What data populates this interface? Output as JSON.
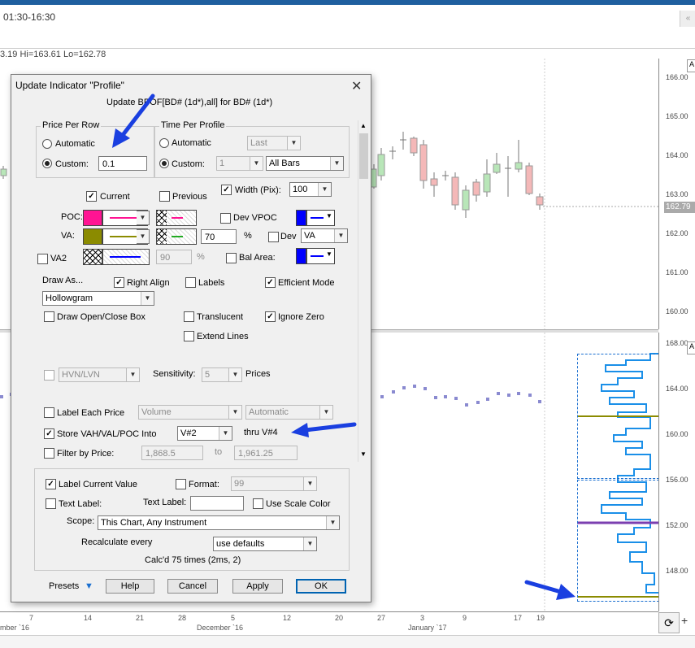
{
  "chart": {
    "title": "01:30-16:30",
    "stats": "3.19 Hi=163.61 Lo=162.78",
    "corner_button": "«",
    "right_axis_label": "A",
    "last_price": "162.79",
    "upper_ticks": [
      "166.00",
      "165.00",
      "164.00",
      "163.00",
      "162.00",
      "161.00",
      "160.00"
    ],
    "lower_ticks": [
      "168.00",
      "164.00",
      "160.00",
      "156.00",
      "152.00",
      "148.00"
    ],
    "date_ticks": [
      "7",
      "14",
      "21",
      "28",
      "5",
      "12",
      "20",
      "27",
      "3",
      "9",
      "17",
      "19"
    ],
    "months": [
      "mber `16",
      "December `16",
      "January `17"
    ],
    "reload_icon": "⟳",
    "add_tab": "+"
  },
  "dialog": {
    "title": "Update Indicator \"Profile\"",
    "close": "✕",
    "subtitle": "Update BPOF[BD# (1d*),all] for BD# (1d*)",
    "price_per_row": {
      "title": "Price Per Row",
      "automatic": "Automatic",
      "custom": "Custom:",
      "custom_value": "0.1"
    },
    "time_per_profile": {
      "title": "Time Per Profile",
      "automatic": "Automatic",
      "auto_select": "Last",
      "custom": "Custom:",
      "custom_value": "1",
      "bars_select": "All Bars"
    },
    "current": "Current",
    "previous": "Previous",
    "width_label": "Width (Pix):",
    "width_value": "100",
    "poc": "POC:",
    "va": "VA:",
    "va_pct": "70",
    "pct": "%",
    "dev_vpoc": "Dev VPOC",
    "dev": "Dev",
    "dev_select": "VA",
    "va2": "VA2",
    "va2_pct": "90",
    "va2_pct_sym": "%",
    "bal_area": "Bal Area:",
    "draw_as": "Draw As...",
    "right_align": "Right Align",
    "labels": "Labels",
    "efficient_mode": "Efficient Mode",
    "draw_as_select": "Hollowgram",
    "draw_open_close": "Draw Open/Close Box",
    "translucent": "Translucent",
    "ignore_zero": "Ignore Zero",
    "extend_lines": "Extend Lines",
    "hvn_select": "HVN/LVN",
    "sensitivity": "Sensitivity:",
    "sensitivity_value": "5",
    "prices": "Prices",
    "label_each_price": "Label Each Price",
    "volume_select": "Volume",
    "automatic_select": "Automatic",
    "store_vah": "Store VAH/VAL/POC Into",
    "store_select": "V#2",
    "thru": "thru V#4",
    "filter_price": "Filter by Price:",
    "filter_from": "1,868.5",
    "to": "to",
    "filter_to": "1,961.25",
    "label_current_value": "Label Current Value",
    "format": "Format:",
    "format_value": "99",
    "text_label_cb": "Text Label:",
    "text_label": "Text Label:",
    "use_scale_color": "Use Scale Color",
    "scope": "Scope:",
    "scope_value": "This Chart, Any Instrument",
    "recalc": "Recalculate every",
    "recalc_value": "use defaults",
    "calcd": "Calc'd 75 times (2ms, 2)",
    "presets": "Presets",
    "help": "Help",
    "cancel": "Cancel",
    "apply": "Apply",
    "ok": "OK"
  },
  "colors": {
    "poc": "#ff1493",
    "va": "#8b8b00",
    "bal_area": "#0000ff",
    "annotation_arrow": "#1a3fe0"
  }
}
